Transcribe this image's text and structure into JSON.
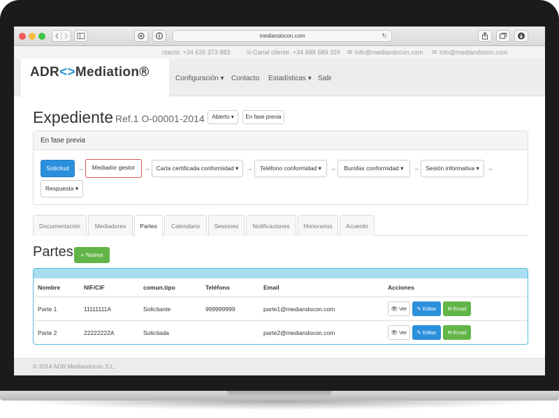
{
  "browser": {
    "url": "mediandocon.com",
    "reload_icon": "↻"
  },
  "topbar": {
    "phone": "ntacto: +34 635 373 883",
    "canal": "Canal cliente: +34 688 689 329",
    "email1": "info@mediandocon.com",
    "email2": "info@mediandocon.com"
  },
  "header": {
    "logo_a": "ADR",
    "logo_b": "<>",
    "logo_c": "Mediation®",
    "nav": [
      "Configuración ▾",
      "Contacto",
      "Estadísticas ▾",
      "Salir"
    ]
  },
  "expediente": {
    "title": "Expediente",
    "ref": "Ref.1 O-00001-2014",
    "status_btn": "Abierto ▾",
    "phase_btn": "En fase previa"
  },
  "flow": {
    "heading": "En fase previa",
    "steps": [
      "Solicitud",
      "Mediador gestor",
      "Carta certificada conformidad ▾",
      "Teléfono conformidad ▾",
      "Burofax conformidad ▾",
      "Sesión informativa ▾",
      "Respuesta ▾"
    ],
    "arrow": "→"
  },
  "tabs": [
    "Documentación",
    "Mediadores",
    "Partes",
    "Calendario",
    "Sesiones",
    "Notificaciones",
    "Honorarios",
    "Acuerdo"
  ],
  "partes": {
    "title": "Partes",
    "new_btn": "+ Nueva",
    "headers": [
      "Nombre",
      "NIF/CIF",
      "comun.tipo",
      "Teléfono",
      "Email",
      "Acciones"
    ],
    "rows": [
      {
        "nombre": "Parte 1",
        "nif": "11111111A",
        "tipo": "Solicitante",
        "telefono": "999999999",
        "email": "parte1@mediandocon.com"
      },
      {
        "nombre": "Parte 2",
        "nif": "22222222A",
        "tipo": "Solicitada",
        "telefono": "",
        "email": "parte2@mediandocon.com"
      }
    ],
    "actions": {
      "ver": "👁 Ver",
      "editar": "✎ Editar",
      "email": "✉ Email"
    }
  },
  "footer": {
    "text": "© 2014 ADR Mediandocon S.L."
  }
}
